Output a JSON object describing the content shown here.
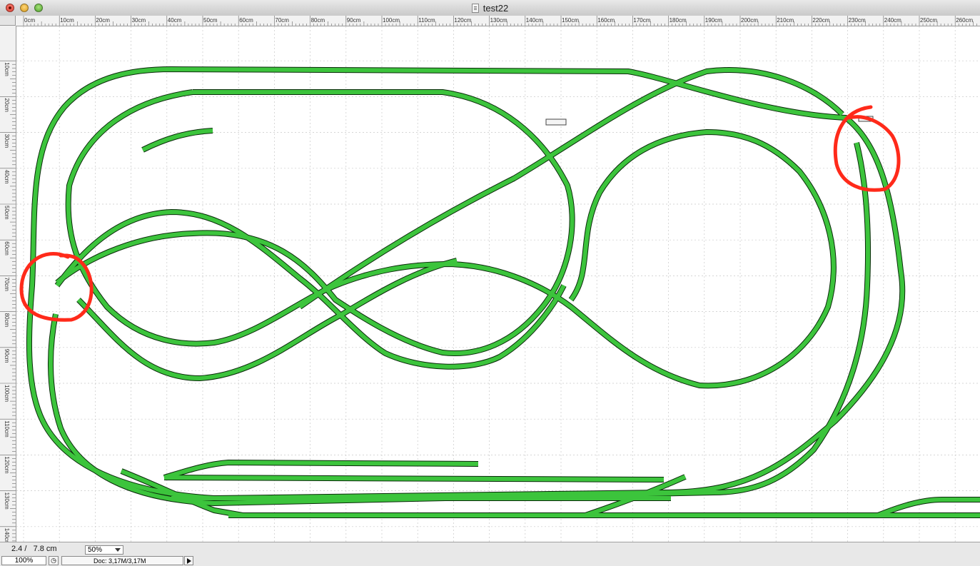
{
  "window": {
    "title": "test22"
  },
  "rulers": {
    "horizontal": [
      "0cm",
      "10cm",
      "20cm",
      "30cm",
      "40cm",
      "50cm",
      "60cm",
      "70cm",
      "80cm",
      "90cm",
      "100cm",
      "110cm",
      "120cm",
      "130cm",
      "140cm",
      "150cm",
      "160cm",
      "170cm",
      "180cm",
      "190cm",
      "200cm",
      "210cm",
      "220cm",
      "230cm",
      "240cm",
      "250cm",
      "260cm"
    ],
    "vertical": [
      "10cm",
      "20cm",
      "30cm",
      "40cm",
      "50cm",
      "60cm",
      "70cm",
      "80cm",
      "90cm",
      "100cm",
      "110cm",
      "120cm",
      "130cm",
      "140cm"
    ]
  },
  "colors": {
    "track_fill": "#3cc43c",
    "track_edge": "#0a2a0a",
    "annotation": "#ff2a1a",
    "grid": "#c8c8c8"
  },
  "status": {
    "coords": "2.4 /   7.8 cm",
    "zoom_select": "50%",
    "zoom_field": "100%",
    "doc_size": "Doc: 3,17M/3,17M"
  }
}
